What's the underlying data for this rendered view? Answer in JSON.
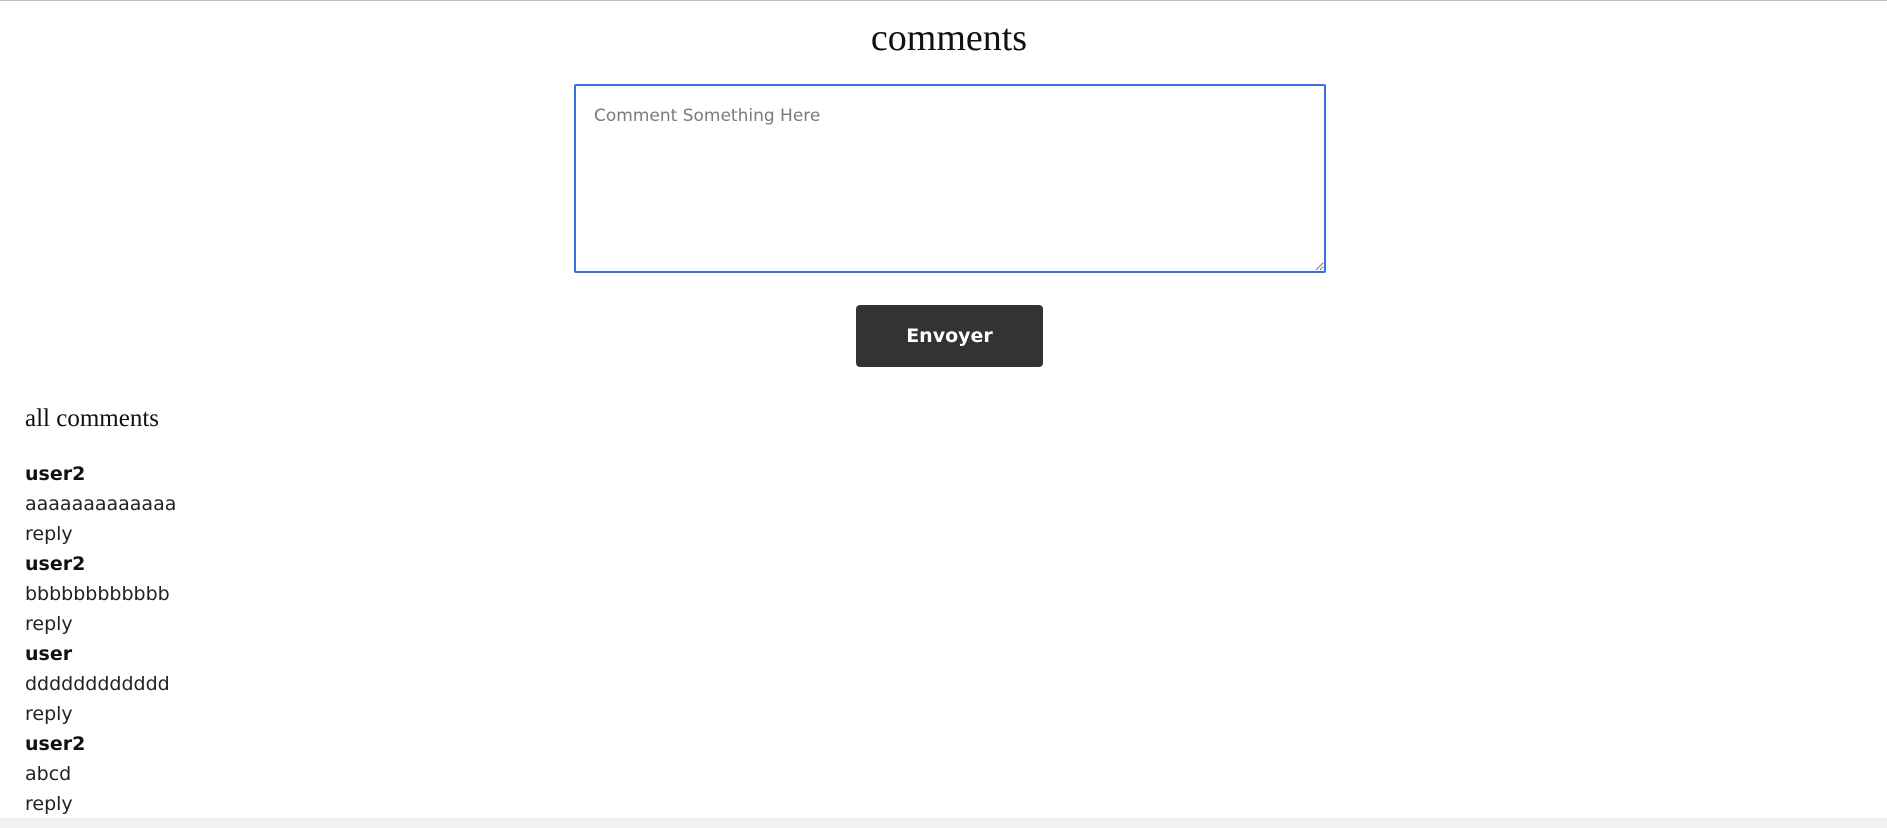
{
  "page": {
    "title": "comments"
  },
  "form": {
    "comment_placeholder": "Comment Something Here",
    "comment_value": "",
    "submit_label": "Envoyer"
  },
  "comments_section": {
    "heading": "all comments",
    "reply_label": "reply",
    "comments": [
      {
        "author": "user2",
        "text": "aaaaaaaaaaaaa"
      },
      {
        "author": "user2",
        "text": "bbbbbbbbbbbb"
      },
      {
        "author": "user",
        "text": "dddddddddddd"
      },
      {
        "author": "user2",
        "text": "abcd"
      }
    ]
  },
  "colors": {
    "focus_border": "#3b6fe0",
    "button_background": "#333333",
    "button_text": "#ffffff"
  }
}
